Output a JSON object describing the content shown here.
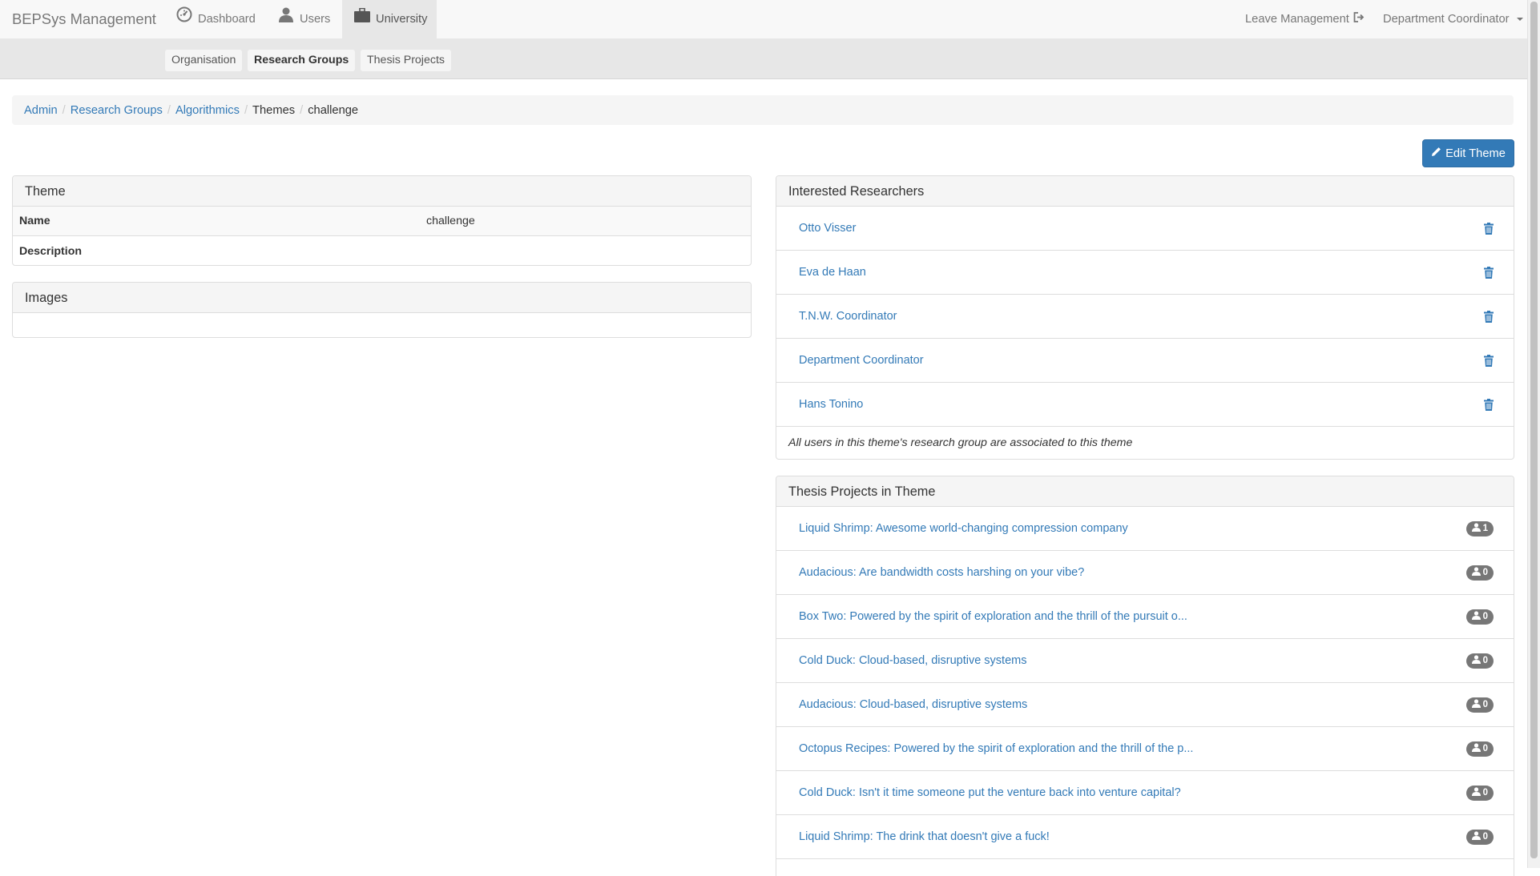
{
  "navbar": {
    "brand": "BEPSys Management",
    "items": [
      {
        "label": "Dashboard",
        "icon": "dashboard-icon"
      },
      {
        "label": "Users",
        "icon": "user-icon"
      },
      {
        "label": "University",
        "icon": "briefcase-icon",
        "active": true
      }
    ],
    "right": {
      "leave_label": "Leave Management",
      "role_label": "Department Coordinator"
    }
  },
  "subnav": {
    "items": [
      {
        "label": "Organisation"
      },
      {
        "label": "Research Groups",
        "active": true
      },
      {
        "label": "Thesis Projects"
      }
    ]
  },
  "breadcrumb": [
    "Admin",
    "Research Groups",
    "Algorithmics",
    "Themes",
    "challenge"
  ],
  "edit_button": "Edit Theme",
  "theme_panel": {
    "title": "Theme",
    "rows": [
      {
        "label": "Name",
        "value": "challenge"
      },
      {
        "label": "Description",
        "value": ""
      }
    ]
  },
  "images_panel": {
    "title": "Images"
  },
  "researchers_panel": {
    "title": "Interested Researchers",
    "items": [
      "Otto Visser",
      "Eva de Haan",
      "T.N.W. Coordinator",
      "Department Coordinator",
      "Hans Tonino"
    ],
    "note": "All users in this theme's research group are associated to this theme"
  },
  "projects_panel": {
    "title": "Thesis Projects in Theme",
    "items": [
      {
        "title": "Liquid Shrimp: Awesome world-changing compression company",
        "count": "1"
      },
      {
        "title": "Audacious: Are bandwidth costs harshing on your vibe?",
        "count": "0"
      },
      {
        "title": "Box Two: Powered by the spirit of exploration and the thrill of the pursuit o...",
        "count": "0"
      },
      {
        "title": "Cold Duck: Cloud-based, disruptive systems",
        "count": "0"
      },
      {
        "title": "Audacious: Cloud-based, disruptive systems",
        "count": "0"
      },
      {
        "title": "Octopus Recipes: Powered by the spirit of exploration and the thrill of the p...",
        "count": "0"
      },
      {
        "title": "Cold Duck: Isn't it time someone put the venture back into venture capital?",
        "count": "0"
      },
      {
        "title": "Liquid Shrimp: The drink that doesn't give a fuck!",
        "count": "0"
      }
    ]
  },
  "colors": {
    "link": "#337ab7",
    "primary": "#337ab7",
    "badge": "#777777"
  }
}
